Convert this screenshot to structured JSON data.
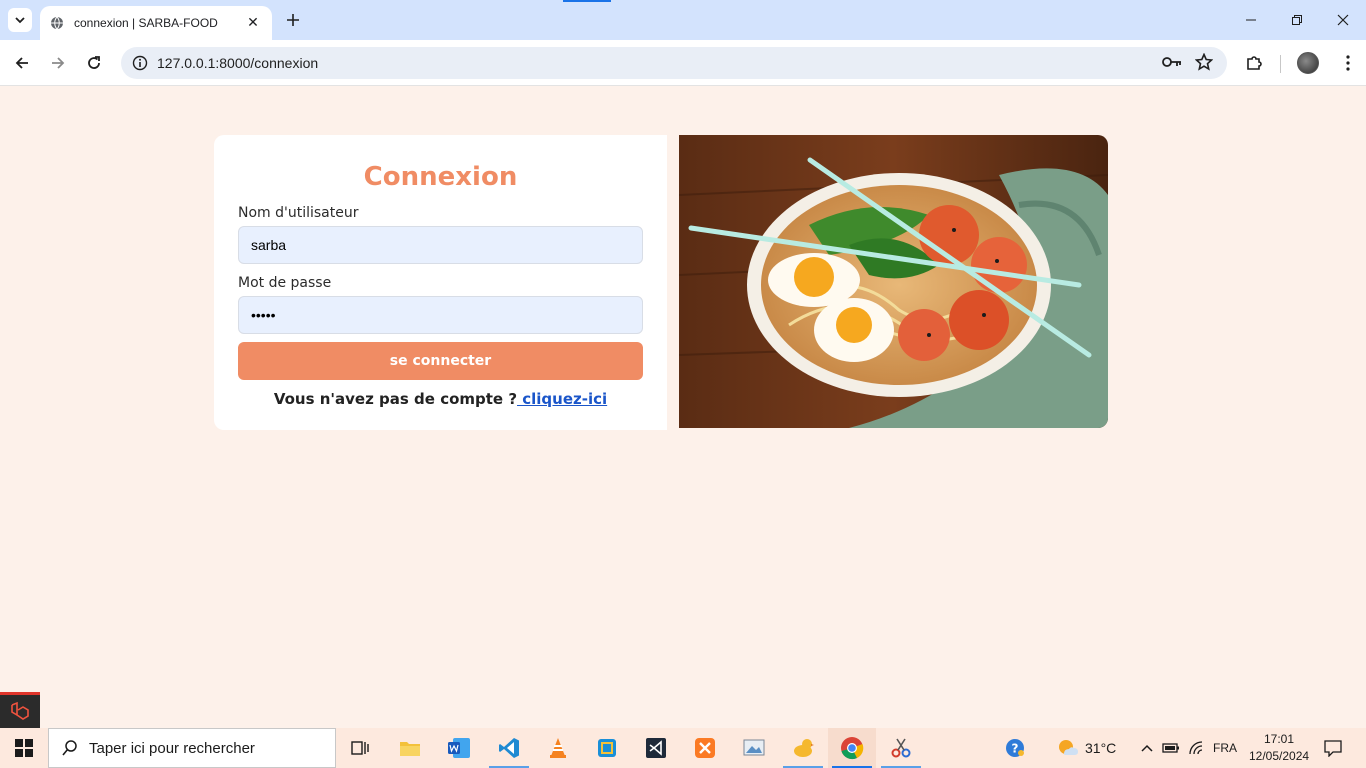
{
  "browser": {
    "tab_title": "connexion | SARBA-FOOD",
    "url": "127.0.0.1:8000/connexion"
  },
  "login": {
    "title": "Connexion",
    "username_label": "Nom d'utilisateur",
    "username_value": "sarba",
    "password_label": "Mot de passe",
    "password_value": "•••••",
    "submit_label": "se connecter",
    "register_prompt": "Vous n'avez pas de compte ?",
    "register_link": " cliquez-ici"
  },
  "taskbar": {
    "search_placeholder": "Taper ici pour rechercher",
    "weather": "31°C",
    "language": "FRA",
    "time": "17:01",
    "date": "12/05/2024"
  },
  "colors": {
    "accent": "#f08c64",
    "page_bg": "#fdf1ea",
    "link": "#1a55c9"
  }
}
